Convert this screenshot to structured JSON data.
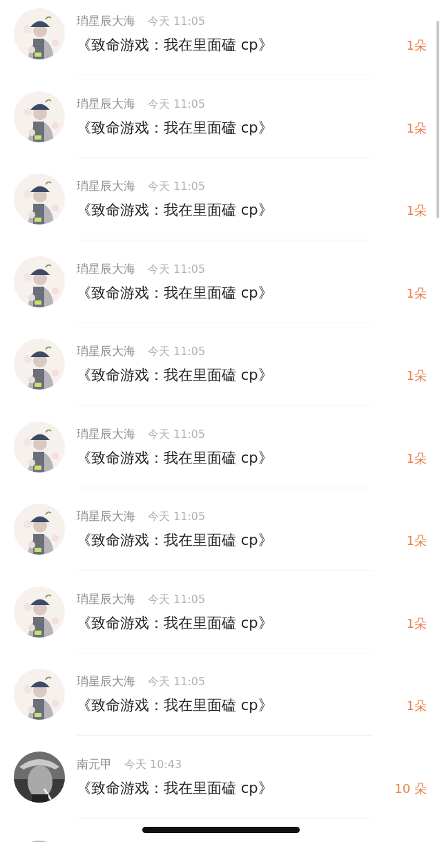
{
  "messages": [
    {
      "name": "琑星辰大海",
      "time": "今天 11:05",
      "title": "《致命游戏：我在里面磕 cp》",
      "count": "1朵",
      "avatar": {
        "kind": "light"
      }
    },
    {
      "name": "琑星辰大海",
      "time": "今天 11:05",
      "title": "《致命游戏：我在里面磕 cp》",
      "count": "1朵",
      "avatar": {
        "kind": "light"
      }
    },
    {
      "name": "琑星辰大海",
      "time": "今天 11:05",
      "title": "《致命游戏：我在里面磕 cp》",
      "count": "1朵",
      "avatar": {
        "kind": "light"
      }
    },
    {
      "name": "琑星辰大海",
      "time": "今天 11:05",
      "title": "《致命游戏：我在里面磕 cp》",
      "count": "1朵",
      "avatar": {
        "kind": "light"
      }
    },
    {
      "name": "琑星辰大海",
      "time": "今天 11:05",
      "title": "《致命游戏：我在里面磕 cp》",
      "count": "1朵",
      "avatar": {
        "kind": "light"
      }
    },
    {
      "name": "琑星辰大海",
      "time": "今天 11:05",
      "title": "《致命游戏：我在里面磕 cp》",
      "count": "1朵",
      "avatar": {
        "kind": "light"
      }
    },
    {
      "name": "琑星辰大海",
      "time": "今天 11:05",
      "title": "《致命游戏：我在里面磕 cp》",
      "count": "1朵",
      "avatar": {
        "kind": "light"
      }
    },
    {
      "name": "琑星辰大海",
      "time": "今天 11:05",
      "title": "《致命游戏：我在里面磕 cp》",
      "count": "1朵",
      "avatar": {
        "kind": "light"
      }
    },
    {
      "name": "琑星辰大海",
      "time": "今天 11:05",
      "title": "《致命游戏：我在里面磕 cp》",
      "count": "1朵",
      "avatar": {
        "kind": "light"
      }
    },
    {
      "name": "南元甲",
      "time": "今天 10:43",
      "title": "《致命游戏：我在里面磕 cp》",
      "count": "10 朵",
      "avatar": {
        "kind": "dark"
      }
    }
  ],
  "next_row": {
    "avatar": {
      "kind": "grey"
    }
  }
}
